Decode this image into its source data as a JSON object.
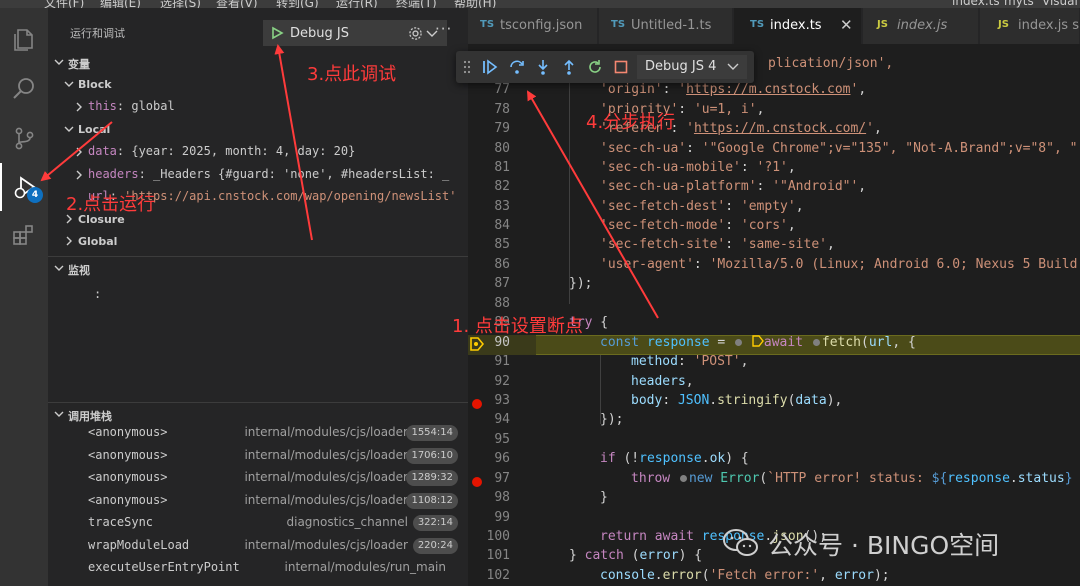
{
  "menu": [
    "文件(F)",
    "编辑(E)",
    "选择(S)",
    "查看(V)",
    "转到(G)",
    "运行(R)",
    "终端(T)",
    "帮助(H)",
    "index.ts",
    "myts",
    "Visual"
  ],
  "activity": {
    "debug_badge": "4"
  },
  "panel": {
    "title": "运行和调试",
    "config": "Debug JS",
    "variables_title": "变量",
    "scopes": {
      "block": "Block",
      "local": "Local",
      "closure": "Closure",
      "global": "Global"
    },
    "block_vars": [
      {
        "name": "this",
        "sep": ": ",
        "value": "global"
      }
    ],
    "local_vars": [
      {
        "name": "data",
        "sep": ": ",
        "value": "{year: 2025, month: 4, day: 20}"
      },
      {
        "name": "headers",
        "sep": ": ",
        "value": "_Headers {#guard: 'none', #headersList: _"
      },
      {
        "name": "url",
        "sep": ": ",
        "value": "'https://api.cnstock.com/wap/opening/newsList'"
      }
    ],
    "watch_title": "监视",
    "watch_empty": ":",
    "callstack_title": "调用堆栈",
    "callstack": [
      {
        "fn": "<anonymous>",
        "src": "internal/modules/cjs/loader",
        "loc": "1554:14"
      },
      {
        "fn": "<anonymous>",
        "src": "internal/modules/cjs/loader",
        "loc": "1706:10"
      },
      {
        "fn": "<anonymous>",
        "src": "internal/modules/cjs/loader",
        "loc": "1289:32"
      },
      {
        "fn": "<anonymous>",
        "src": "internal/modules/cjs/loader",
        "loc": "1108:12"
      },
      {
        "fn": "traceSync",
        "src": "diagnostics_channel",
        "loc": "322:14"
      },
      {
        "fn": "wrapModuleLoad",
        "src": "internal/modules/cjs/loader",
        "loc": "220:24"
      },
      {
        "fn": "executeUserEntryPoint",
        "src": "internal/modules/run_main",
        "loc": ""
      }
    ]
  },
  "tabs": [
    {
      "icon": "TS",
      "label": "tsconfig.json",
      "active": false
    },
    {
      "icon": "TS",
      "label": "Untitled-1.ts",
      "active": false
    },
    {
      "icon": "TS",
      "label": "index.ts",
      "active": true
    },
    {
      "icon": "JS",
      "label": "index.js",
      "active": false
    },
    {
      "icon": "JS",
      "label": "index.js src",
      "active": false
    }
  ],
  "debug_toolbar": {
    "config": "Debug JS 4"
  },
  "editor": {
    "current_line": "90",
    "breakpoints": [
      "93",
      "97"
    ],
    "lines": [
      {
        "n": "77",
        "code": "'origin': 'https://m.cnstock.com',"
      },
      {
        "n": "78",
        "code": "'priority': 'u=1, i',"
      },
      {
        "n": "79",
        "code": "'referer': 'https://m.cnstock.com/',"
      },
      {
        "n": "80",
        "code": "'sec-ch-ua': '\"Google Chrome\";v=\"135\", \"Not-A.Brand\";v=\"8\", \""
      },
      {
        "n": "81",
        "code": "'sec-ch-ua-mobile': '?1',"
      },
      {
        "n": "82",
        "code": "'sec-ch-ua-platform': '\"Android\"',"
      },
      {
        "n": "83",
        "code": "'sec-fetch-dest': 'empty',"
      },
      {
        "n": "84",
        "code": "'sec-fetch-mode': 'cors',"
      },
      {
        "n": "85",
        "code": "'sec-fetch-site': 'same-site',"
      },
      {
        "n": "86",
        "code": "'user-agent': 'Mozilla/5.0 (Linux; Android 6.0; Nexus 5 Build"
      },
      {
        "n": "87",
        "code": "});"
      },
      {
        "n": "88",
        "code": ""
      },
      {
        "n": "89",
        "code": "try {"
      },
      {
        "n": "90",
        "code": "const response = await fetch(url, {"
      },
      {
        "n": "91",
        "code": "method: 'POST',"
      },
      {
        "n": "92",
        "code": "headers,"
      },
      {
        "n": "93",
        "code": "body: JSON.stringify(data),"
      },
      {
        "n": "94",
        "code": "});"
      },
      {
        "n": "95",
        "code": ""
      },
      {
        "n": "96",
        "code": "if (!response.ok) {"
      },
      {
        "n": "97",
        "code": "throw new Error(`HTTP error! status: ${response.status}"
      },
      {
        "n": "98",
        "code": "}"
      },
      {
        "n": "99",
        "code": ""
      },
      {
        "n": "100",
        "code": "return await response.json();"
      },
      {
        "n": "101",
        "code": "} catch (error) {"
      },
      {
        "n": "102",
        "code": "console.error('Fetch error:', error);"
      }
    ],
    "partial_top": "plication/json',"
  },
  "annotations": {
    "step1": "1. 点击设置断点",
    "step2": "2.点击运行",
    "step3": "3.点此调试",
    "step4": "4.分步执行"
  },
  "watermark": "公众号 · BINGO空间",
  "colors": {
    "annotation": "#ff3b3b",
    "breakpoint": "#e51400",
    "current_line": "#4b4b18",
    "accent": "#0e70c0"
  }
}
